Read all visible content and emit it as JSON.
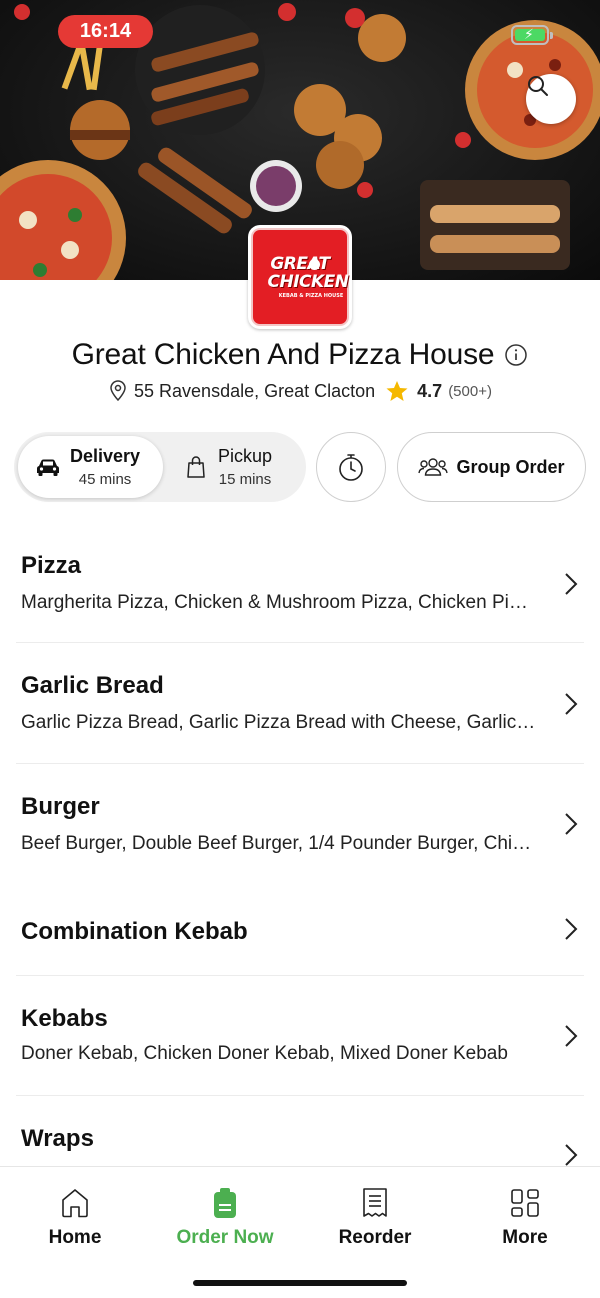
{
  "status_bar": {
    "time": "16:14"
  },
  "restaurant": {
    "name": "Great Chicken And Pizza House",
    "address": "55 Ravensdale, Great Clacton",
    "rating": "4.7",
    "rating_count": "(500+)",
    "logo": {
      "line1": "GREAT",
      "line2": "CHICKEN",
      "line3": "KEBAB & PIZZA HOUSE"
    }
  },
  "order_mode": {
    "delivery": {
      "label": "Delivery",
      "time": "45 mins",
      "selected": true
    },
    "pickup": {
      "label": "Pickup",
      "time": "15 mins",
      "selected": false
    }
  },
  "group_order_label": "Group Order",
  "menu": [
    {
      "title": "Pizza",
      "description": "Margherita Pizza, Chicken & Mushroom Pizza, Chicken Pizza"
    },
    {
      "title": "Garlic Bread",
      "description": "Garlic Pizza Bread, Garlic Pizza Bread with Cheese, Garlic Bread"
    },
    {
      "title": "Burger",
      "description": "Beef Burger, Double Beef Burger, 1/4 Pounder Burger, Chicken Burger"
    },
    {
      "title": "Combination Kebab",
      "description": ""
    },
    {
      "title": "Kebabs",
      "description": "Doner Kebab, Chicken Doner Kebab, Mixed Doner Kebab"
    },
    {
      "title": "Wraps",
      "description": ""
    }
  ],
  "tabs": [
    {
      "label": "Home",
      "icon": "home-icon",
      "active": false
    },
    {
      "label": "Order Now",
      "icon": "order-bag-icon",
      "active": true
    },
    {
      "label": "Reorder",
      "icon": "receipt-icon",
      "active": false
    },
    {
      "label": "More",
      "icon": "grid-icon",
      "active": false
    }
  ],
  "colors": {
    "accent": "#4caf50",
    "brand_red": "#e31e24",
    "star": "#f5b800",
    "status_pill": "#e53935"
  }
}
